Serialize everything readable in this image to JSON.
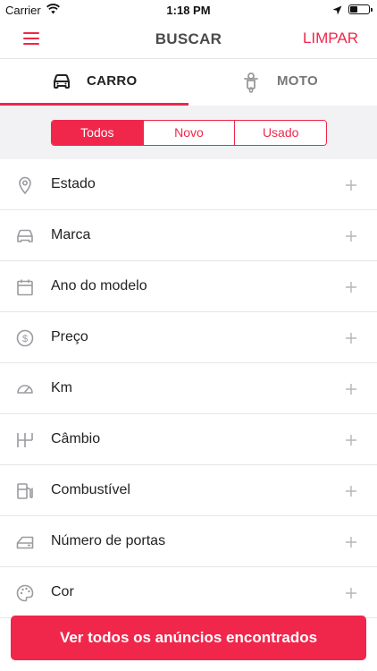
{
  "status_bar": {
    "carrier": "Carrier",
    "time": "1:18 PM"
  },
  "nav": {
    "title": "BUSCAR",
    "clear_label": "LIMPAR"
  },
  "tabs": [
    {
      "label": "CARRO",
      "icon": "car-icon",
      "active": true
    },
    {
      "label": "MOTO",
      "icon": "motorcycle-icon",
      "active": false
    }
  ],
  "segmented": {
    "options": [
      "Todos",
      "Novo",
      "Usado"
    ],
    "selected": "Todos"
  },
  "filters": [
    {
      "label": "Estado",
      "icon": "location-pin-icon"
    },
    {
      "label": "Marca",
      "icon": "car-icon"
    },
    {
      "label": "Ano do modelo",
      "icon": "calendar-icon"
    },
    {
      "label": "Preço",
      "icon": "dollar-coin-icon"
    },
    {
      "label": "Km",
      "icon": "speedometer-icon"
    },
    {
      "label": "Câmbio",
      "icon": "gearshift-icon"
    },
    {
      "label": "Combustível",
      "icon": "fuel-pump-icon"
    },
    {
      "label": "Número de portas",
      "icon": "car-door-icon"
    },
    {
      "label": "Cor",
      "icon": "palette-icon"
    }
  ],
  "cta_label": "Ver todos os anúncios encontrados",
  "colors": {
    "accent": "#f0264b",
    "icon_gray": "#9a9aa0",
    "divider": "#e6e6e8",
    "segment_bg": "#f2f2f4"
  }
}
